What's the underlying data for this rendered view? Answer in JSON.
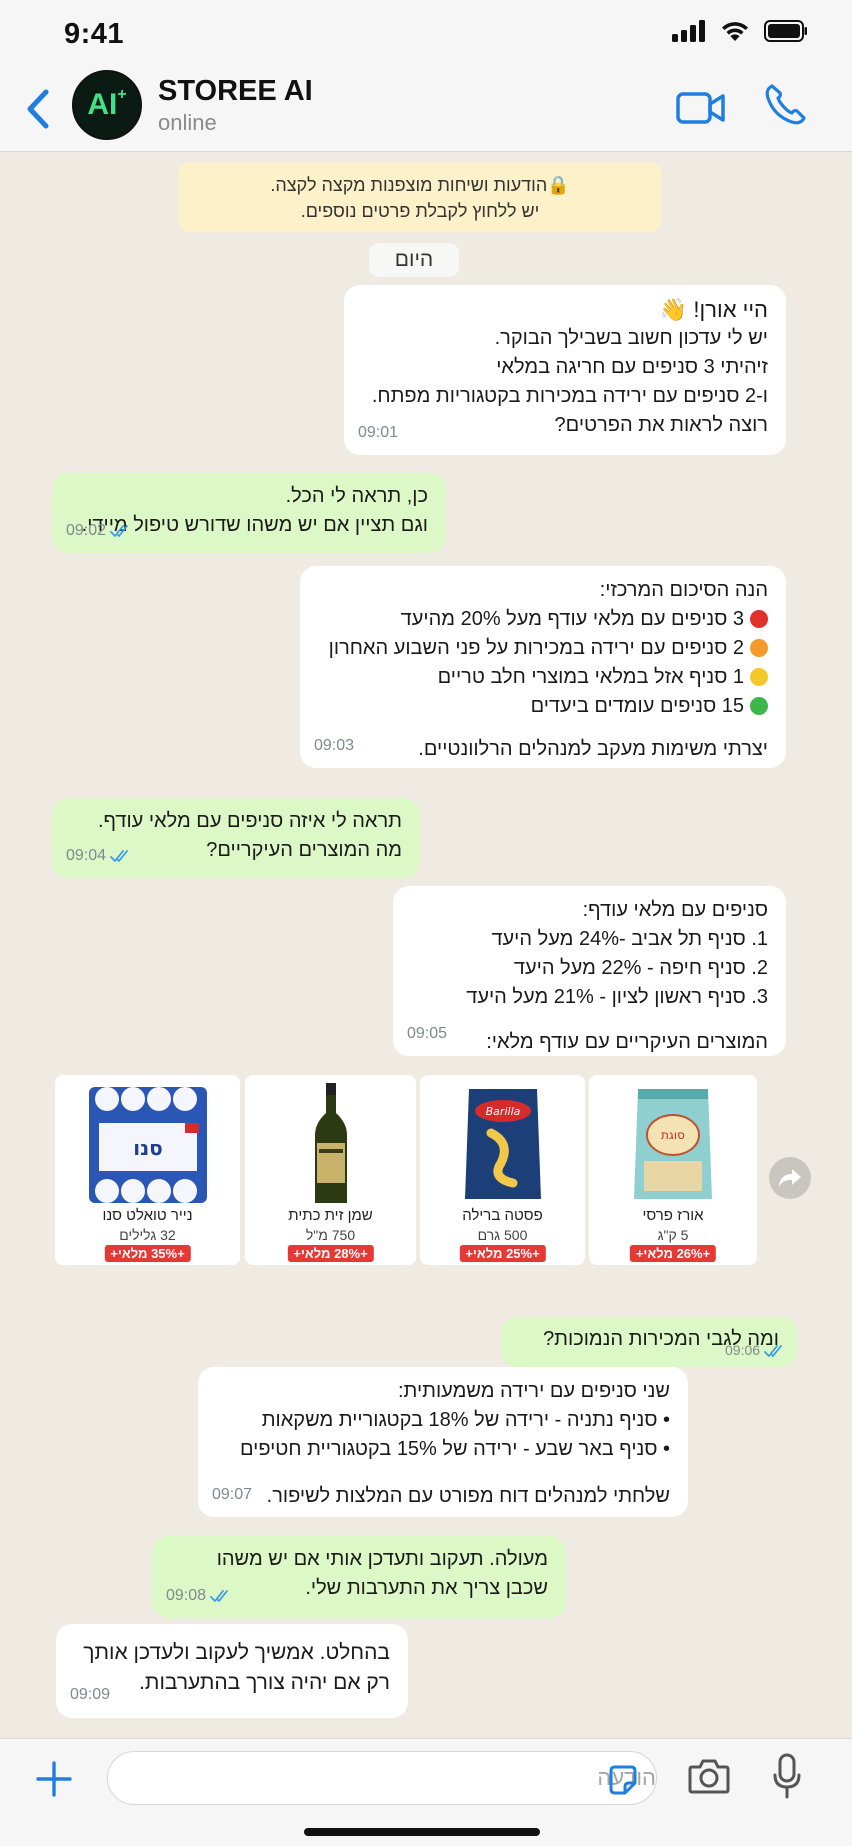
{
  "status_bar": {
    "time": "9:41"
  },
  "header": {
    "name": "STOREE AI",
    "status": "online",
    "avatar_text": "AI",
    "avatar_sup": "+"
  },
  "chat": {
    "encryption_notice": [
      "הודעות ושיחות מוצפנות מקצה לקצה.",
      "יש ללחוץ לקבלת פרטים נוספים."
    ],
    "date_label": "היום",
    "messages": [
      {
        "lines": [
          "היי אורן! 👋",
          "יש לי עדכון חשוב בשבילך הבוקר.",
          "זיהיתי 3 סניפים עם חריגה במלאי",
          "ו-2 סניפים עם ירידה במכירות בקטגוריות מפתח.",
          "רוצה לראות את הפרטים?"
        ],
        "time": "09:01"
      },
      {
        "lines": [
          "כן, תראה לי הכל.",
          "וגם תציין אם יש משהו שדורש טיפול מיידי."
        ],
        "time": "09:02"
      },
      {
        "lines": [
          "הנה הסיכום המרכזי:",
          "3 סניפים עם מלאי עודף מעל 20% מהיעד",
          "2 סניפים עם ירידה במכירות על פני השבוע האחרון",
          "1 סניף אזל במלאי במוצרי חלב טריים",
          "15 סניפים עומדים ביעדים",
          "יצרתי משימות מעקב למנהלים הרלוונטיים."
        ],
        "time": "09:03"
      },
      {
        "lines": [
          "תראה לי איזה סניפים עם מלאי עודף.",
          "מה המוצרים העיקריים?"
        ],
        "time": "09:04"
      },
      {
        "lines": [
          "סניפים עם מלאי עודף:",
          "1. סניף תל אביב -24% מעל היעד",
          "2. סניף חיפה - 22% מעל היעד",
          "3. סניף ראשון לציון - 21% מעל היעד",
          "המוצרים העיקריים עם עודף מלאי:"
        ],
        "time": "09:05"
      },
      {
        "lines": [
          "ומה לגבי המכירות הנמוכות?"
        ],
        "time": "09:06"
      },
      {
        "lines": [
          "שני סניפים עם ירידה משמעותית:",
          "• סניף נתניה - ירידה של 18% בקטגוריית משקאות",
          "• סניף באר שבע - ירידה של 15% בקטגוריית חטיפים",
          "שלחתי למנהלים דוח מפורט עם המלצות לשיפור."
        ],
        "time": "09:07"
      },
      {
        "lines": [
          "מעולה. תעקוב ותעדכן אותי אם יש משהו",
          "שכבן צריך את התערבות שלי."
        ],
        "time": "09:08"
      },
      {
        "lines": [
          "בהחלט. אמשיך לעקוב ולעדכן אותך",
          "רק אם יהיה צורך בהתערבות."
        ],
        "time": "09:09"
      }
    ],
    "status_colors": [
      "#e0322b",
      "#f39a2a",
      "#f3c82a",
      "#3cb64a"
    ],
    "products": [
      {
        "name": "אורז פרסי",
        "size": "5 ק\"ג",
        "badge": "+26% מלאי+",
        "image_text": "סוגת"
      },
      {
        "name": "פסטה ברילה",
        "size": "500 גרם",
        "badge": "+25% מלאי+",
        "image_text": "Barilla"
      },
      {
        "name": "שמן זית כתית",
        "size": "750 מ\"ל",
        "badge": "+28% מלאי+",
        "image_text": ""
      },
      {
        "name": "נייר טואלט סנו",
        "size": "32 גלילים",
        "badge": "+35% מלאי+",
        "image_text": "סנו"
      }
    ]
  },
  "input": {
    "placeholder": "הודעה"
  },
  "colors": {
    "accent": "#1f7fe0",
    "bubble_out": "#dcf8c6",
    "bubble_in": "#ffffff",
    "badge": "#e53935"
  }
}
